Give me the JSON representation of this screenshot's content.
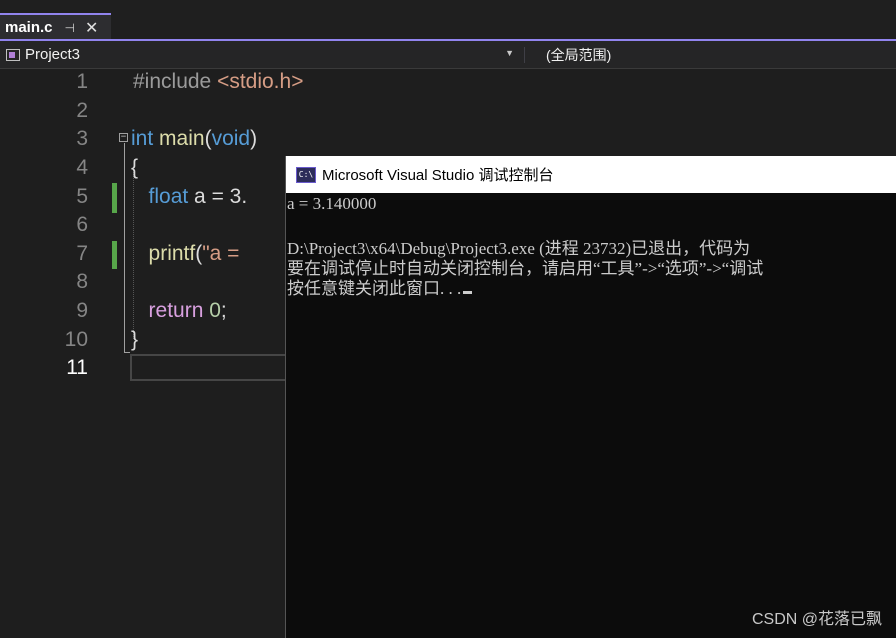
{
  "tab": {
    "label": "main.c",
    "pin_glyph": "⊣",
    "close_glyph": "✕"
  },
  "navbar": {
    "project": "Project3",
    "scope": "(全局范围)"
  },
  "editor": {
    "line_numbers": [
      "1",
      "2",
      "3",
      "4",
      "5",
      "6",
      "7",
      "8",
      "9",
      "10",
      "11"
    ],
    "current_line": 11,
    "lines": {
      "l1": {
        "hash": "#include ",
        "header": "<stdio.h>"
      },
      "l3": {
        "type": "int",
        "space": " ",
        "name": "main",
        "open": "(",
        "param": "void",
        "close": ")"
      },
      "l4": {
        "brace": "{"
      },
      "l5": {
        "indent": "   ",
        "type": "float",
        "rest": " a = 3."
      },
      "l7": {
        "indent": "   ",
        "fn": "printf",
        "open": "(",
        "str": "\"a ="
      },
      "l9": {
        "indent": "   ",
        "kw": "return",
        "space": " ",
        "num": "0",
        "semi": ";"
      },
      "l10": {
        "brace": "}"
      }
    }
  },
  "console": {
    "title": "Microsoft Visual Studio 调试控制台",
    "icon_text": "C:\\",
    "lines": [
      "a = 3.140000",
      "",
      "D:\\Project3\\x64\\Debug\\Project3.exe (进程 23732)已退出，代码为",
      "要在调试停止时自动关闭控制台，请启用“工具”->“选项”->“调试",
      "按任意键关闭此窗口. . ."
    ]
  },
  "watermark": "CSDN @花落已飘",
  "colors": {
    "accent": "#9184ee",
    "keyword": "#569cd6",
    "function": "#dcdcaa",
    "string": "#d69d85",
    "number": "#b5cea8",
    "control_keyword": "#d8a0df",
    "change_bar": "#57a64a"
  }
}
